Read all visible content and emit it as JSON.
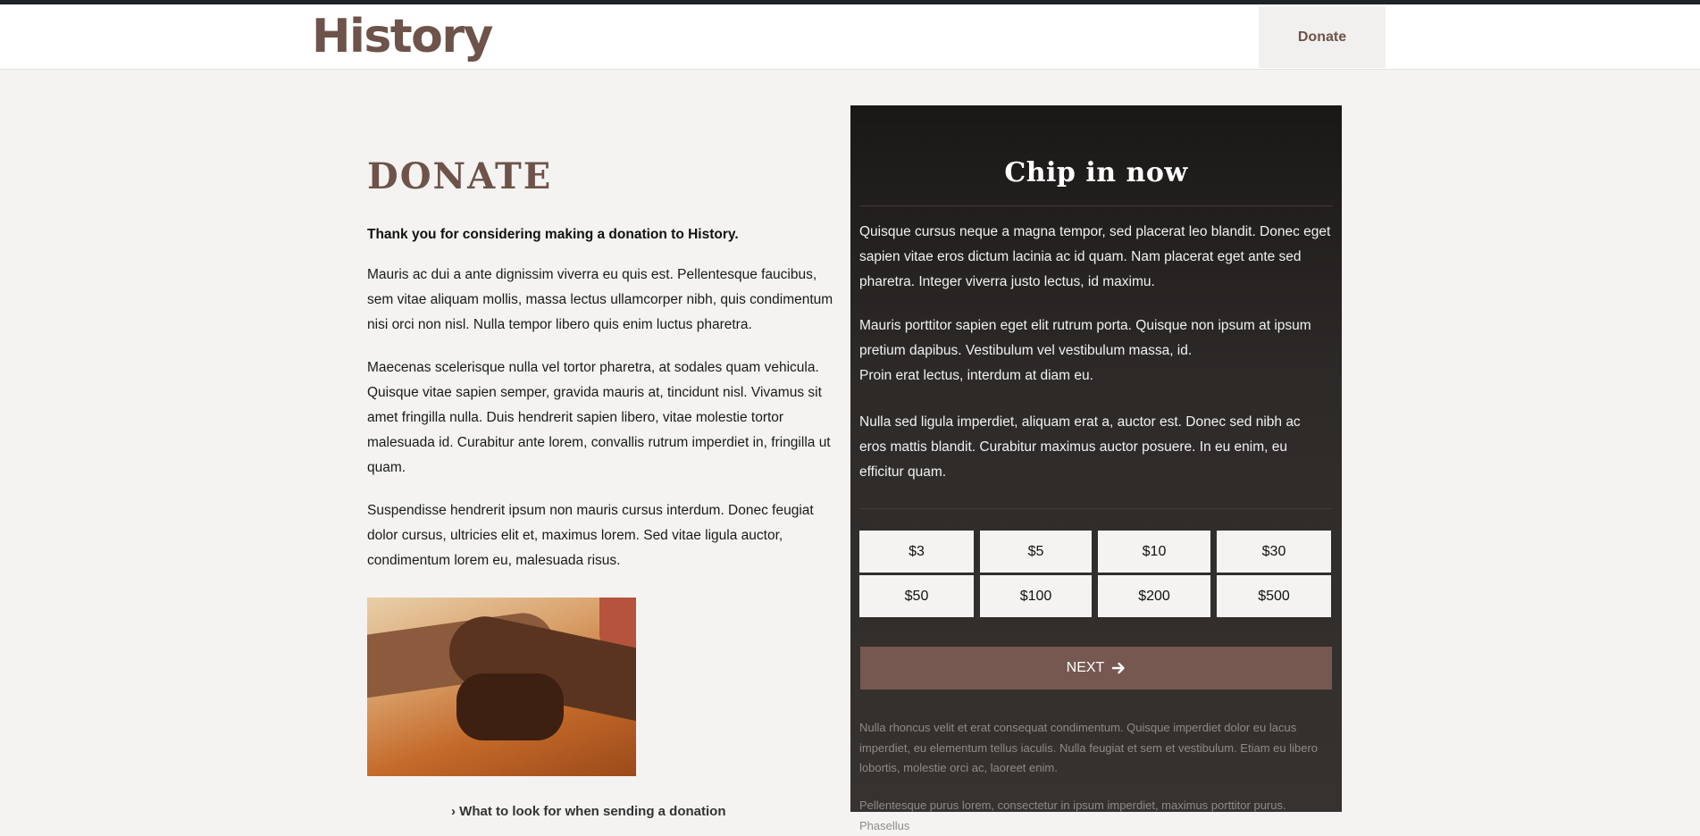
{
  "header": {
    "site_title": "History",
    "nav_donate": "Donate"
  },
  "main": {
    "title": "DONATE",
    "intro": "Thank you for considering making a donation to History.",
    "paragraphs": [
      "Mauris ac dui a ante dignissim viverra eu quis est. Pellentesque faucibus, sem vitae aliquam mollis, massa lectus ullamcorper nibh, quis condimentum nisi orci non nisl. Nulla tempor libero quis enim luctus pharetra.",
      "Maecenas scelerisque nulla vel tortor pharetra, at sodales quam vehicula. Quisque vitae sapien semper, gravida mauris at, tincidunt nisl. Vivamus sit amet fringilla nulla. Duis hendrerit sapien libero, vitae molestie tortor malesuada id. Curabitur ante lorem, convallis rutrum imperdiet in, fringilla ut quam.",
      "Suspendisse hendrerit ipsum non mauris cursus interdum. Donec feugiat dolor cursus, ultricies elit et, maximus lorem. Sed vitae ligula auctor, condimentum lorem eu, malesuada risus."
    ],
    "bottom_link": "What to look for when sending a donation"
  },
  "panel": {
    "title": "Chip in now",
    "paragraphs": [
      "Quisque cursus neque a magna tempor, sed placerat leo blandit. Donec eget sapien vitae eros dictum lacinia ac id quam. Nam placerat eget ante sed pharetra. Integer viverra justo lectus, id maximu.",
      "Mauris porttitor sapien eget elit rutrum porta. Quisque non ipsum at ipsum pretium dapibus. Vestibulum vel vestibulum massa, id.",
      "Proin erat lectus, interdum at diam eu.",
      "Nulla sed ligula imperdiet, aliquam erat a, auctor est. Donec sed nibh ac eros mattis blandit. Curabitur maximus auctor posuere. In eu enim, eu efficitur quam."
    ],
    "amounts": [
      "$3",
      "$5",
      "$10",
      "$30",
      "$50",
      "$100",
      "$200",
      "$500"
    ],
    "next_label": "NEXT",
    "fine_print": [
      "Nulla rhoncus velit et erat consequat condimentum. Quisque imperdiet dolor eu lacus imperdiet, eu elementum tellus iaculis. Nulla feugiat et sem et vestibulum. Etiam eu libero lobortis, molestie orci ac, laoreet enim.",
      "Pellentesque purus lorem, consectetur in ipsum imperdiet, maximus porttitor purus. Phasellus"
    ]
  },
  "icons": {
    "next": "arrow-right-icon",
    "link": "chevron-right-icon"
  },
  "colors": {
    "brand": "#6e534a",
    "next_button": "#765850",
    "panel_bg": "#2e2a28",
    "page_bg": "#f4f3f1"
  }
}
